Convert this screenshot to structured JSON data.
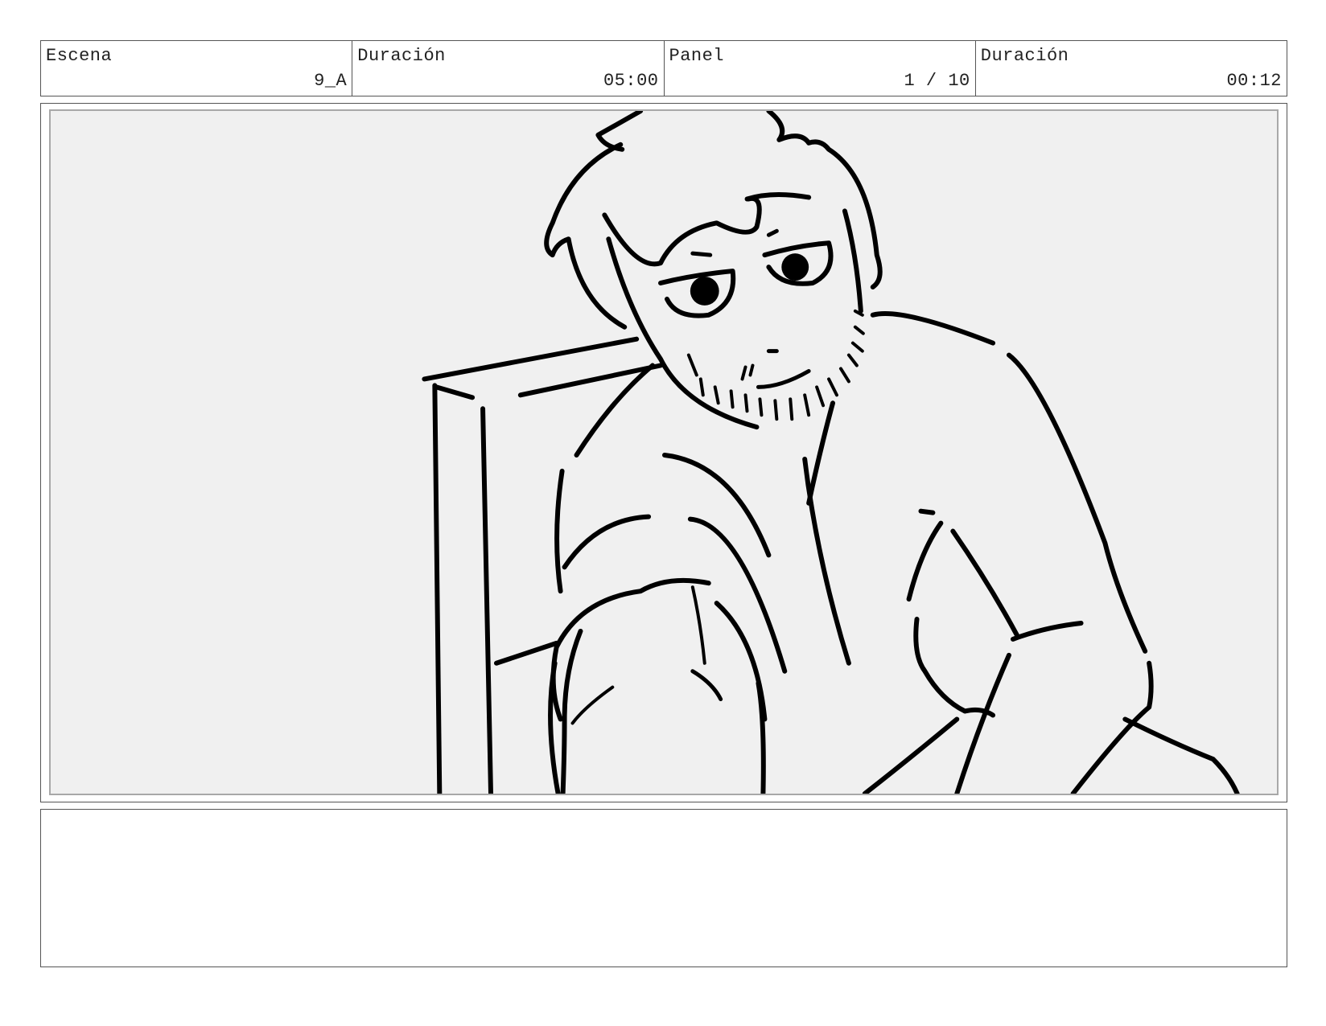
{
  "header": {
    "cells": [
      {
        "label": "Escena",
        "value": "9_A"
      },
      {
        "label": "Duración",
        "value": "05:00"
      },
      {
        "label": "Panel",
        "value": "1 / 10"
      },
      {
        "label": "Duración",
        "value": "00:12"
      }
    ]
  },
  "notes": {
    "text": ""
  },
  "colors": {
    "ink": "#000000",
    "canvas": "#f0f0f0",
    "border": "#a8a8a8"
  }
}
